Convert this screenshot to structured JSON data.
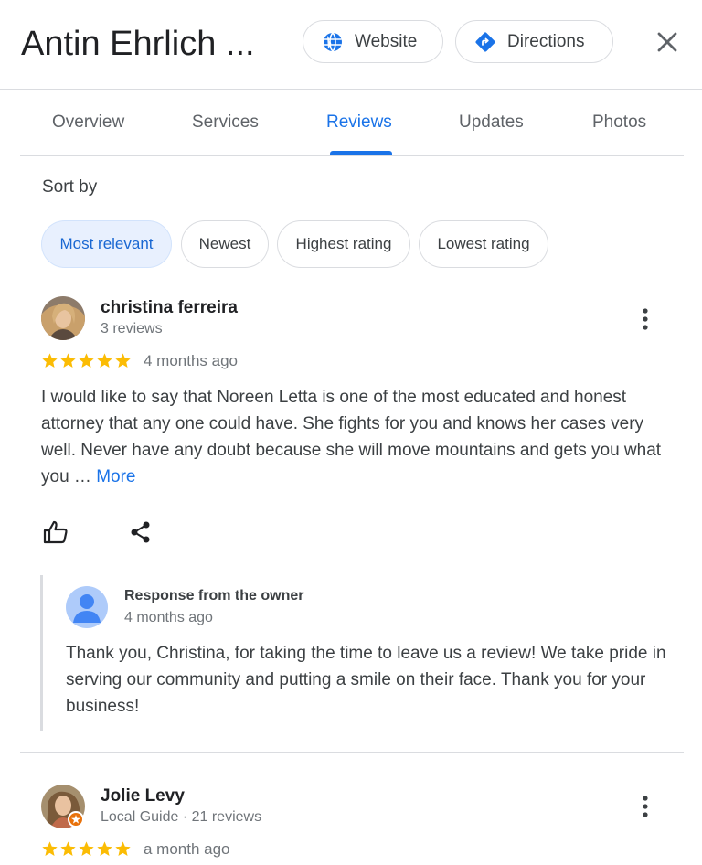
{
  "header": {
    "title": "Antin Ehrlich ...",
    "website_label": "Website",
    "directions_label": "Directions"
  },
  "tabs": [
    {
      "label": "Overview"
    },
    {
      "label": "Services"
    },
    {
      "label": "Reviews",
      "active": true
    },
    {
      "label": "Updates"
    },
    {
      "label": "Photos"
    }
  ],
  "sort": {
    "label": "Sort by",
    "options": [
      {
        "label": "Most relevant",
        "selected": true
      },
      {
        "label": "Newest"
      },
      {
        "label": "Highest rating"
      },
      {
        "label": "Lowest rating"
      }
    ]
  },
  "reviews": [
    {
      "name": "christina ferreira",
      "meta": "3 reviews",
      "rating": 5,
      "date": "4 months ago",
      "text": "I would like to say that Noreen Letta is one of the most educated and honest attorney that any one could have. She fights for you and knows her cases very well. Never have any doubt because she will move mountains and gets you what you … ",
      "more_label": "More",
      "owner_response": {
        "title": "Response from the owner",
        "date": "4 months ago",
        "text": "Thank you, Christina, for taking the time to leave us a review! We take pride in serving our community and putting a smile on their face. Thank you for your business!"
      }
    },
    {
      "name": "Jolie Levy",
      "meta": "Local Guide · 21 reviews",
      "rating": 5,
      "date": "a month ago"
    }
  ],
  "colors": {
    "accent": "#1a73e8",
    "star": "#fbbc04",
    "chip_selected_bg": "#e8f0fe"
  }
}
